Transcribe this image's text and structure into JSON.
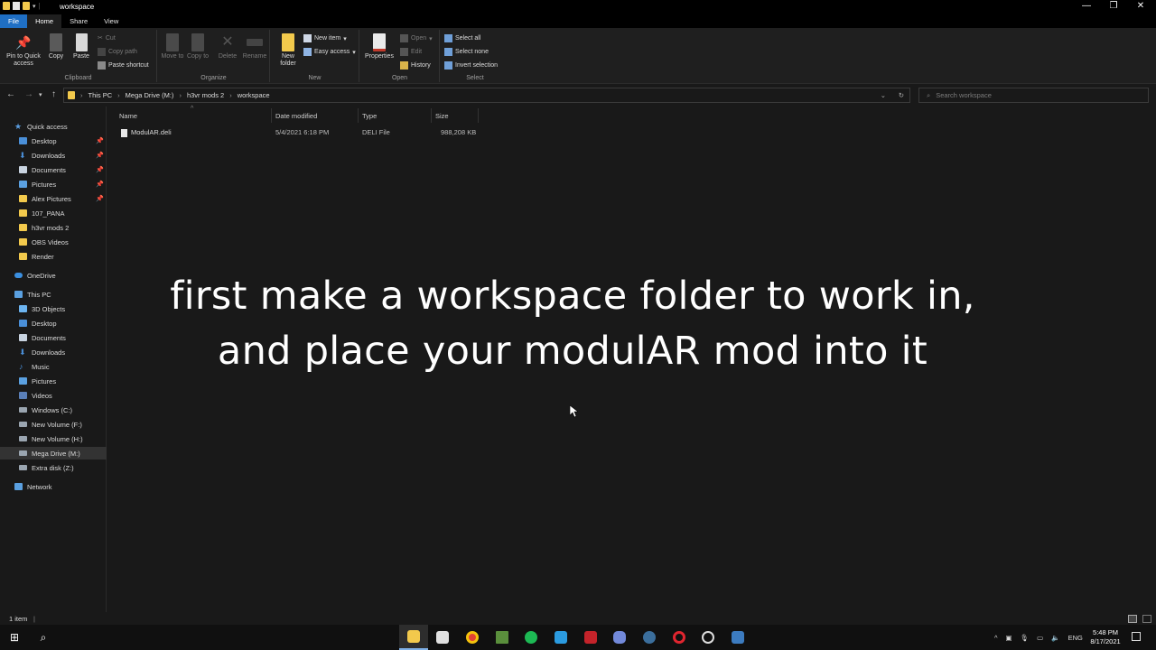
{
  "window": {
    "title": "workspace",
    "controls": [
      "minimize",
      "maximize",
      "close"
    ]
  },
  "ribbon_tabs": [
    "File",
    "Home",
    "Share",
    "View"
  ],
  "ribbon": {
    "clipboard": {
      "label": "Clipboard",
      "pin": "Pin to Quick access",
      "copy": "Copy",
      "paste": "Paste",
      "cut": "Cut",
      "copy_path": "Copy path",
      "paste_shortcut": "Paste shortcut"
    },
    "organize": {
      "label": "Organize",
      "move_to": "Move to",
      "copy_to": "Copy to",
      "delete": "Delete",
      "rename": "Rename"
    },
    "new": {
      "label": "New",
      "new_folder": "New folder",
      "new_item": "New item",
      "easy_access": "Easy access"
    },
    "open": {
      "label": "Open",
      "properties": "Properties",
      "open": "Open",
      "edit": "Edit",
      "history": "History"
    },
    "select": {
      "label": "Select",
      "select_all": "Select all",
      "select_none": "Select none",
      "invert_selection": "Invert selection"
    }
  },
  "address": {
    "crumbs": [
      "This PC",
      "Mega Drive (M:)",
      "h3vr mods 2",
      "workspace"
    ],
    "search_placeholder": "Search workspace"
  },
  "nav": {
    "quick_access": "Quick access",
    "quick_items": [
      "Desktop",
      "Downloads",
      "Documents",
      "Pictures",
      "Alex Pictures",
      "107_PANA",
      "h3vr mods 2",
      "OBS Videos",
      "Render"
    ],
    "onedrive": "OneDrive",
    "this_pc": "This PC",
    "pc_items": [
      "3D Objects",
      "Desktop",
      "Documents",
      "Downloads",
      "Music",
      "Pictures",
      "Videos",
      "Windows (C:)",
      "New Volume (F:)",
      "New Volume (H:)",
      "Mega Drive (M:)",
      "Extra disk (Z:)"
    ],
    "network": "Network"
  },
  "file_list": {
    "columns": [
      "Name",
      "Date modified",
      "Type",
      "Size"
    ],
    "rows": [
      {
        "name": "ModulAR.deli",
        "date": "5/4/2021 6:18 PM",
        "type": "DELI File",
        "size": "988,208 KB"
      }
    ]
  },
  "caption": {
    "line1": "first make a workspace folder to work in,",
    "line2": "and place your modulAR mod into it"
  },
  "status": {
    "count": "1 item"
  },
  "taskbar": {
    "tray_lang": "ENG",
    "time": "5:48 PM",
    "date": "8/17/2021"
  },
  "colors": {
    "file_tab": "#1f6fc4",
    "folder": "#f2c94c",
    "background": "#191919"
  }
}
